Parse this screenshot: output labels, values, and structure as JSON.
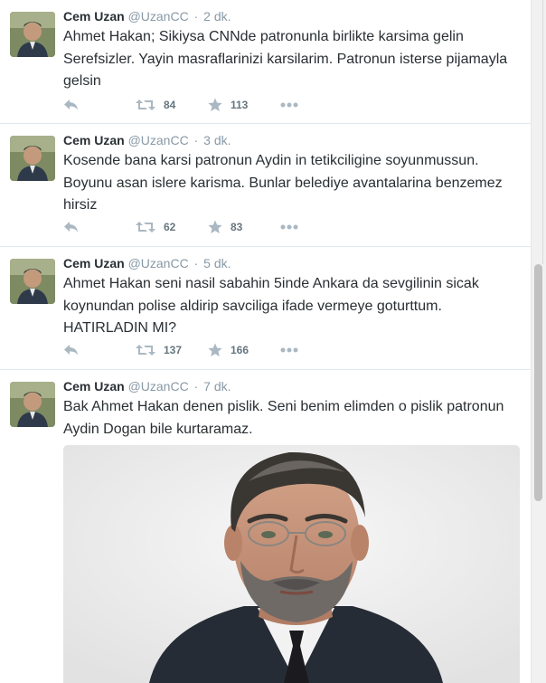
{
  "tweets": [
    {
      "fullname": "Cem Uzan",
      "username": "@UzanCC",
      "time": "2 dk.",
      "text": "Ahmet Hakan; Sikiysa CNNde patronunla birlikte karsima gelin Serefsizler. Yayin masraflarinizi karsilarim. Patronun isterse pijamayla gelsin",
      "retweets": "84",
      "favorites": "113"
    },
    {
      "fullname": "Cem Uzan",
      "username": "@UzanCC",
      "time": "3 dk.",
      "text": "Kosende bana karsi patronun Aydin in tetikciligine soyunmussun. Boyunu asan islere karisma.  Bunlar belediye avantalarina benzemez hirsiz",
      "retweets": "62",
      "favorites": "83"
    },
    {
      "fullname": "Cem Uzan",
      "username": "@UzanCC",
      "time": "5 dk.",
      "text": "Ahmet Hakan seni nasil sabahin 5inde Ankara da sevgilinin sicak koynundan polise aldirip savciliga ifade vermeye goturttum. HATIRLADIN MI?",
      "retweets": "137",
      "favorites": "166"
    },
    {
      "fullname": "Cem Uzan",
      "username": "@UzanCC",
      "time": "7 dk.",
      "text": "Bak Ahmet Hakan denen pislik. Seni benim elimden o pislik patronun Aydin Dogan bile kurtaramaz."
    }
  ],
  "separator": "·",
  "icons": {
    "reply": "reply-icon",
    "retweet": "retweet-icon",
    "favorite": "star-icon",
    "more": "more-icon"
  },
  "colors": {
    "name": "#292f33",
    "meta": "#8899a6",
    "action_icon": "#aab8c2",
    "count": "#66757f",
    "divider": "#e1e8ed"
  }
}
